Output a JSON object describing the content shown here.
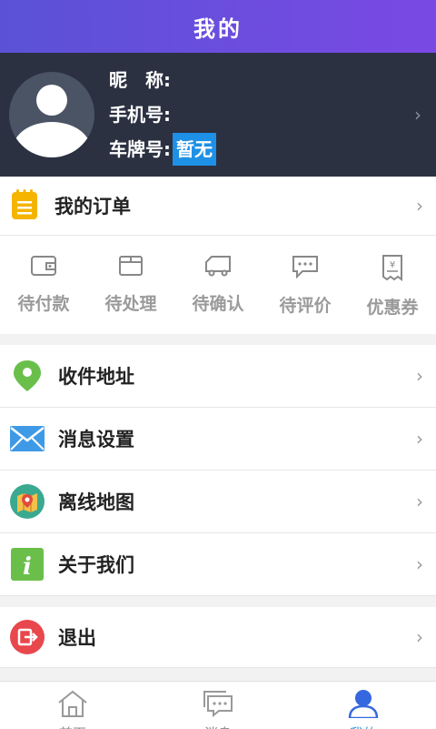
{
  "header": {
    "title": "我的"
  },
  "profile": {
    "nickname_label": "昵　称:",
    "phone_label": "手机号:",
    "plate_label": "车牌号:",
    "plate_value": "暂无"
  },
  "orders": {
    "title": "我的订单",
    "statuses": [
      {
        "label": "待付款",
        "icon": "wallet-icon"
      },
      {
        "label": "待处理",
        "icon": "box-icon"
      },
      {
        "label": "待确认",
        "icon": "truck-icon"
      },
      {
        "label": "待评价",
        "icon": "chat-icon"
      },
      {
        "label": "优惠券",
        "icon": "coupon-icon"
      }
    ]
  },
  "menu": [
    {
      "label": "收件地址",
      "icon": "location-pin-icon"
    },
    {
      "label": "消息设置",
      "icon": "envelope-icon"
    },
    {
      "label": "离线地图",
      "icon": "map-icon"
    },
    {
      "label": "关于我们",
      "icon": "info-icon"
    }
  ],
  "logout": {
    "label": "退出",
    "icon": "exit-icon"
  },
  "tabs": [
    {
      "label": "首页",
      "icon": "home-icon"
    },
    {
      "label": "消息",
      "icon": "message-icon"
    },
    {
      "label": "我的",
      "icon": "user-icon"
    }
  ],
  "colors": {
    "header_gradient_start": "#5a52d6",
    "header_gradient_end": "#7a49e4",
    "profile_bg": "#2b3141",
    "highlight": "#1e90e6",
    "active_tab": "#2f9be8"
  }
}
